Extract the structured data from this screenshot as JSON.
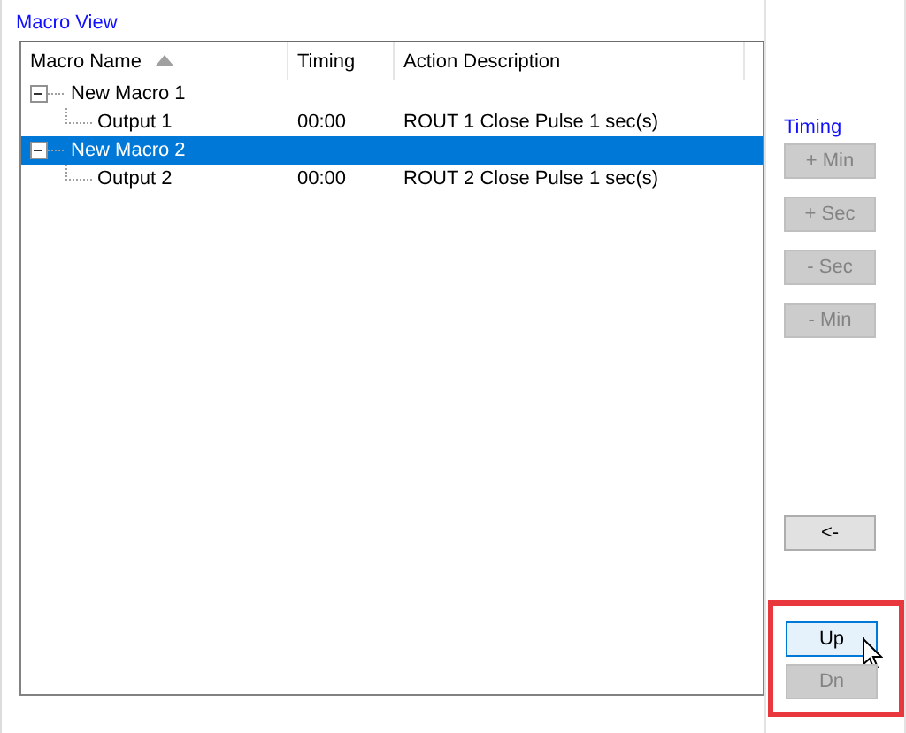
{
  "group_title": "Macro View",
  "columns": [
    {
      "label": "Macro Name",
      "sorted": true
    },
    {
      "label": "Timing",
      "sorted": false
    },
    {
      "label": "Action Description",
      "sorted": false
    }
  ],
  "rows": [
    {
      "name": "New Macro 1",
      "timing": "",
      "action": "",
      "expanded": true,
      "selected": false,
      "children": [
        {
          "name": "Output 1",
          "timing": "00:00",
          "action": "ROUT 1 Close Pulse 1 sec(s)",
          "selected": false
        }
      ]
    },
    {
      "name": "New Macro 2",
      "timing": "",
      "action": "",
      "expanded": true,
      "selected": true,
      "children": [
        {
          "name": "Output 2",
          "timing": "00:00",
          "action": "ROUT 2 Close Pulse 1 sec(s)",
          "selected": false
        }
      ]
    }
  ],
  "timing_label": "Timing",
  "timing_buttons": [
    {
      "label": "+ Min",
      "disabled": true
    },
    {
      "label": "+ Sec",
      "disabled": true
    },
    {
      "label": "- Sec",
      "disabled": true
    },
    {
      "label": "- Min",
      "disabled": true
    }
  ],
  "back_button": {
    "label": "<-",
    "disabled": false
  },
  "order_buttons": [
    {
      "label": "Up",
      "disabled": false,
      "hovered": true
    },
    {
      "label": "Dn",
      "disabled": true,
      "hovered": false
    }
  ],
  "highlight": true
}
